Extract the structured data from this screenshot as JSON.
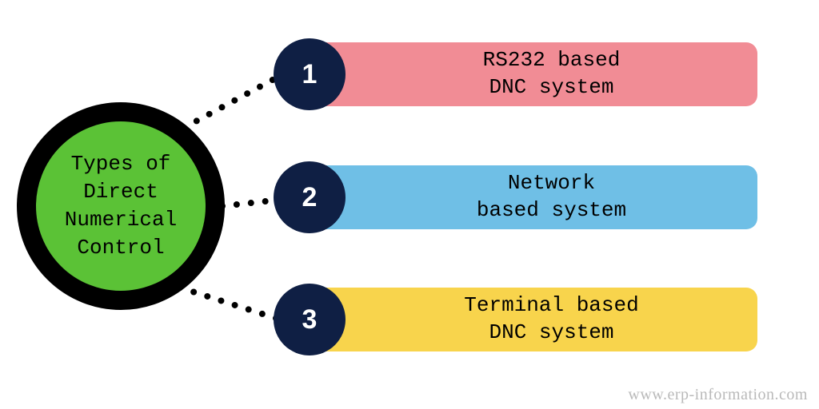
{
  "center": {
    "title": "Types of\nDirect\nNumerical\nControl",
    "fill": "#5bc236",
    "border": "#000000"
  },
  "items": [
    {
      "number": "1",
      "label": "RS232 based\nDNC system",
      "color": "#f18c95"
    },
    {
      "number": "2",
      "label": "Network\nbased system",
      "color": "#6fbfe6"
    },
    {
      "number": "3",
      "label": "Terminal based\nDNC system",
      "color": "#f8d44c"
    }
  ],
  "number_circle_color": "#0f1f44",
  "attribution": "www.erp-information.com"
}
